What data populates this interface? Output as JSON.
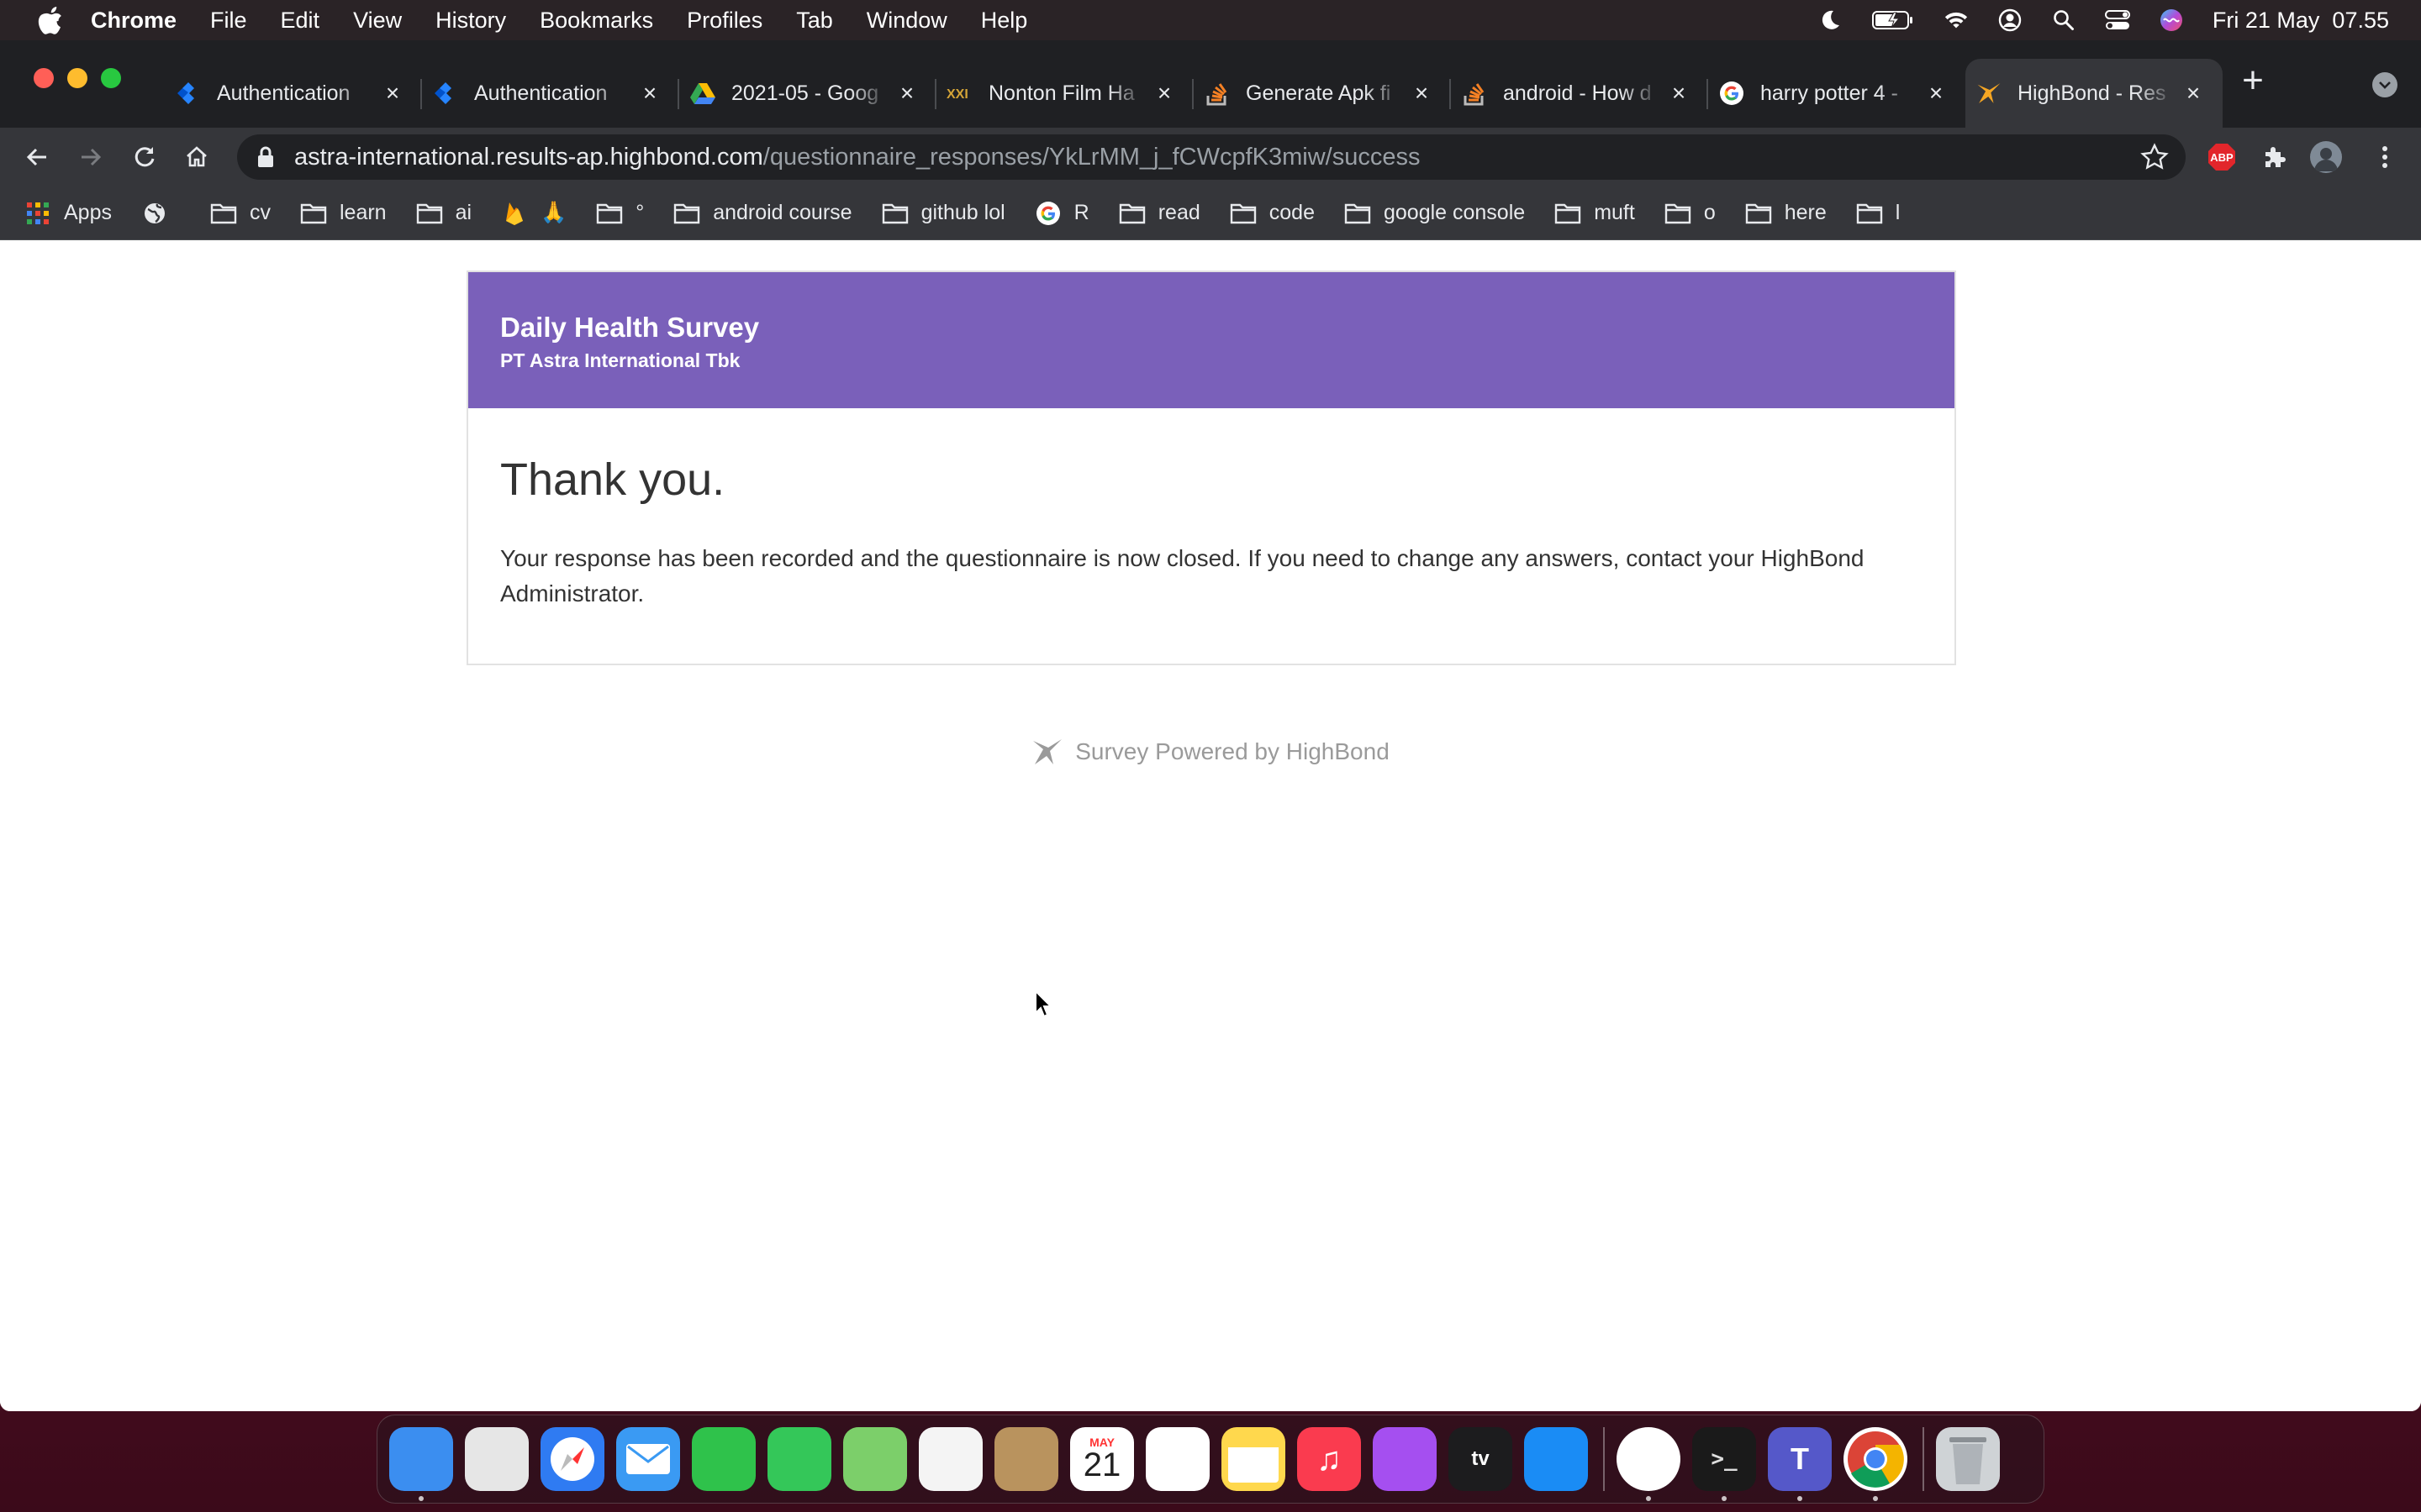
{
  "menubar": {
    "app_name": "Chrome",
    "items": [
      "File",
      "Edit",
      "View",
      "History",
      "Bookmarks",
      "Profiles",
      "Tab",
      "Window",
      "Help"
    ],
    "clock": "Fri 21 May  07.55"
  },
  "tabs": [
    {
      "title": "Authentication",
      "icon": "jira-icon"
    },
    {
      "title": "Authentication",
      "icon": "jira-icon"
    },
    {
      "title": "2021-05 - Goog",
      "icon": "google-drive-icon"
    },
    {
      "title": "Nonton Film Ha",
      "icon": "xxi-icon"
    },
    {
      "title": "Generate Apk fi",
      "icon": "stackoverflow-icon"
    },
    {
      "title": "android - How d",
      "icon": "stackoverflow-icon"
    },
    {
      "title": "harry potter 4 -",
      "icon": "google-icon"
    },
    {
      "title": "HighBond - Res",
      "icon": "highbond-icon",
      "active": true
    }
  ],
  "address": {
    "host": "astra-international.results-ap.highbond.com",
    "path": "/questionnaire_responses/YkLrMM_j_fCWcpfK3miw/success"
  },
  "extensions": {
    "abp_label": "ABP"
  },
  "bookmarks": [
    {
      "label": "Apps",
      "icon": "apps-grid-icon"
    },
    {
      "label": "",
      "icon": "globe-icon"
    },
    {
      "label": "cv",
      "icon": "folder-icon"
    },
    {
      "label": "learn",
      "icon": "folder-icon"
    },
    {
      "label": "ai",
      "icon": "folder-icon"
    },
    {
      "label": "🙏",
      "icon": "firebase-icon"
    },
    {
      "label": "°",
      "icon": "folder-icon"
    },
    {
      "label": "android course",
      "icon": "folder-icon"
    },
    {
      "label": "github lol",
      "icon": "folder-icon"
    },
    {
      "label": "R",
      "icon": "google-icon"
    },
    {
      "label": "read",
      "icon": "folder-icon"
    },
    {
      "label": "code",
      "icon": "folder-icon"
    },
    {
      "label": "google console",
      "icon": "folder-icon"
    },
    {
      "label": "muft",
      "icon": "folder-icon"
    },
    {
      "label": "o",
      "icon": "folder-icon"
    },
    {
      "label": "here",
      "icon": "folder-icon"
    },
    {
      "label": "l",
      "icon": "folder-icon"
    }
  ],
  "survey": {
    "title": "Daily Health Survey",
    "company": "PT Astra International Tbk",
    "thanks": "Thank you.",
    "message": "Your response has been recorded and the questionnaire is now closed. If you need to change any answers, contact your HighBond Administrator.",
    "footer": "Survey Powered by HighBond",
    "header_color": "#7a60ba"
  },
  "calendar": {
    "month": "MAY",
    "day": "21"
  },
  "dock": [
    {
      "name": "finder-icon",
      "color": "#3b8ef0",
      "running": true
    },
    {
      "name": "launchpad-icon",
      "color": "#e6e6e6",
      "running": false
    },
    {
      "name": "safari-icon",
      "color": "#2f7bf2",
      "running": false
    },
    {
      "name": "mail-icon",
      "color": "#3a9af3",
      "running": false
    },
    {
      "name": "facetime-icon",
      "color": "#2fc24b",
      "running": false
    },
    {
      "name": "messages-icon",
      "color": "#34c759",
      "running": false
    },
    {
      "name": "maps-icon",
      "color": "#7ccf6a",
      "running": false
    },
    {
      "name": "photos-icon",
      "color": "#f4f4f4",
      "running": false
    },
    {
      "name": "contacts-icon",
      "color": "#b9935e",
      "running": false
    },
    {
      "name": "calendar-icon",
      "color": "#ffffff",
      "running": false
    },
    {
      "name": "reminders-icon",
      "color": "#ffffff",
      "running": false
    },
    {
      "name": "notes-icon",
      "color": "#ffd84d",
      "running": false
    },
    {
      "name": "music-icon",
      "color": "#fa3b4f",
      "running": false
    },
    {
      "name": "podcasts-icon",
      "color": "#a54ff0",
      "running": false
    },
    {
      "name": "apple-tv-icon",
      "color": "#1c1c1e",
      "running": false
    },
    {
      "name": "app-store-icon",
      "color": "#1a8cf5",
      "running": false
    },
    {
      "name": "android-studio-icon",
      "color": "#ffffff",
      "running": true
    },
    {
      "name": "terminal-icon",
      "color": "#1a1a1a",
      "running": true
    },
    {
      "name": "teams-icon",
      "color": "#5558c9",
      "running": true
    },
    {
      "name": "chrome-icon",
      "color": "#ffffff",
      "running": true
    },
    {
      "name": "trash-icon",
      "color": "#cfd3d6",
      "running": false
    }
  ]
}
